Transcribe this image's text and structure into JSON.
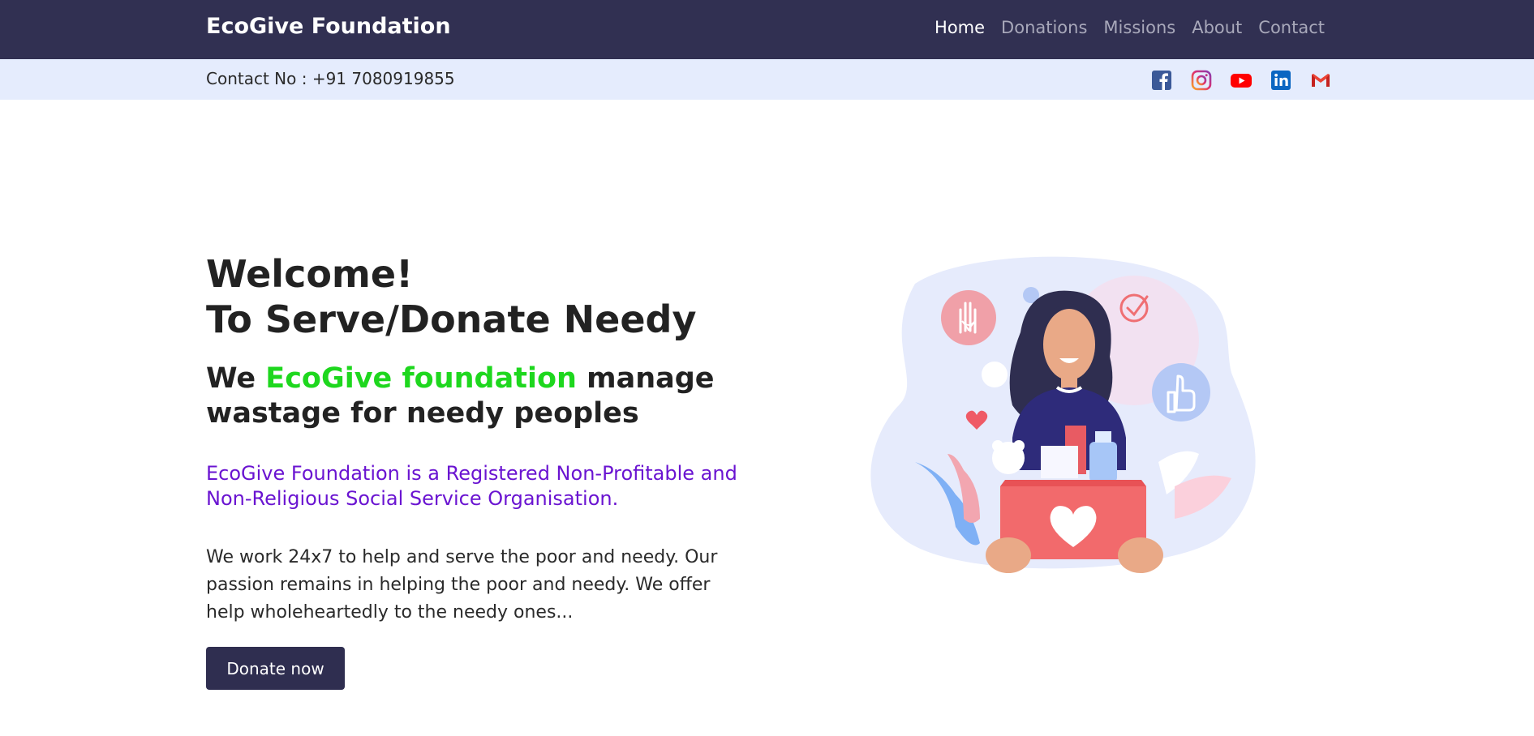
{
  "navbar": {
    "brand": "EcoGive Foundation",
    "links": [
      {
        "label": "Home",
        "active": true
      },
      {
        "label": "Donations",
        "active": false
      },
      {
        "label": "Missions",
        "active": false
      },
      {
        "label": "About",
        "active": false
      },
      {
        "label": "Contact",
        "active": false
      }
    ]
  },
  "topbar": {
    "contact": "Contact No : +91 7080919855",
    "social_icons": [
      "facebook-icon",
      "instagram-icon",
      "youtube-icon",
      "linkedin-icon",
      "gmail-icon"
    ]
  },
  "hero": {
    "title_line1": "Welcome!",
    "title_line2": "To Serve/Donate Needy",
    "tagline_pre": "We ",
    "tagline_highlight": "EcoGive foundation",
    "tagline_post": " manage wastage for needy peoples",
    "registered": "EcoGive Foundation is a Registered Non-Profitable and Non-Religious Social Service Organisation.",
    "description": "We work 24x7 to help and serve the poor and needy. Our passion remains in helping the poor and needy. We offer help wholeheartedly to the needy ones...",
    "button_label": "Donate now"
  },
  "colors": {
    "navbar_bg": "#313052",
    "topbar_bg": "#e5ecfd",
    "highlight_green": "#1ed71e",
    "registered_purple": "#6a14d1",
    "button_bg": "#2f2e50"
  }
}
